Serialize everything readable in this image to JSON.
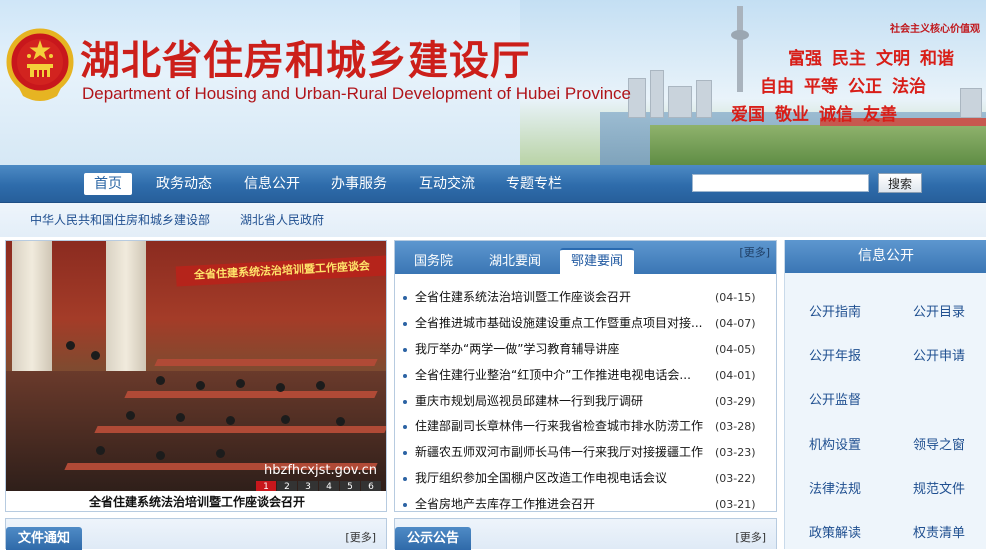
{
  "header": {
    "title_cn": "湖北省住房和城乡建设厅",
    "title_en": "Department of Housing and Urban-Rural Development of Hubei Province",
    "values_label": "社会主义核心价值观",
    "values_row1": [
      "富强",
      "民主",
      "文明",
      "和谐"
    ],
    "values_row2": [
      "自由",
      "平等",
      "公正",
      "法治"
    ],
    "values_row3": [
      "爱国",
      "敬业",
      "诚信",
      "友善"
    ],
    "emblem_icon": "national-emblem-icon"
  },
  "nav": {
    "items": [
      "首页",
      "政务动态",
      "信息公开",
      "办事服务",
      "互动交流",
      "专题专栏"
    ],
    "search_placeholder": "",
    "search_button": "搜索"
  },
  "top_links": [
    "中华人民共和国住房和城乡建设部",
    "湖北省人民政府"
  ],
  "photo": {
    "banner_text": "全省住建系统法治培训暨工作座谈会",
    "watermark": "hbzfhcxjst.gov.cn",
    "pages": [
      "1",
      "2",
      "3",
      "4",
      "5",
      "6"
    ],
    "caption": "全省住建系统法治培训暨工作座谈会召开"
  },
  "news": {
    "tabs": [
      "国务院",
      "湖北要闻",
      "鄂建要闻"
    ],
    "more": "[更多]",
    "items": [
      {
        "title": "全省住建系统法治培训暨工作座谈会召开",
        "date": "(04-15)"
      },
      {
        "title": "全省推进城市基础设施建设重点工作暨重点项目对接...",
        "date": "(04-07)"
      },
      {
        "title": "我厅举办“两学一做”学习教育辅导讲座",
        "date": "(04-05)"
      },
      {
        "title": "全省住建行业整治“红顶中介”工作推进电视电话会...",
        "date": "(04-01)"
      },
      {
        "title": "重庆市规划局巡视员邱建林一行到我厅调研",
        "date": "(03-29)"
      },
      {
        "title": "住建部副司长章林伟一行来我省检查城市排水防涝工作",
        "date": "(03-28)"
      },
      {
        "title": "新疆农五师双河市副师长马伟一行来我厅对接援疆工作",
        "date": "(03-23)"
      },
      {
        "title": "我厅组织参加全国棚户区改造工作电视电话会议",
        "date": "(03-22)"
      },
      {
        "title": "全省房地产去库存工作推进会召开",
        "date": "(03-21)"
      }
    ]
  },
  "info": {
    "title": "信息公开",
    "links": [
      "公开指南",
      "公开目录",
      "公开年报",
      "公开申请",
      "公开监督",
      "",
      "机构设置",
      "领导之窗",
      "法律法规",
      "规范文件",
      "政策解读",
      "权责清单"
    ]
  },
  "bottom": {
    "left_title": "文件通知",
    "left_more": "[更多]",
    "mid_title": "公示公告",
    "mid_more": "[更多]"
  }
}
